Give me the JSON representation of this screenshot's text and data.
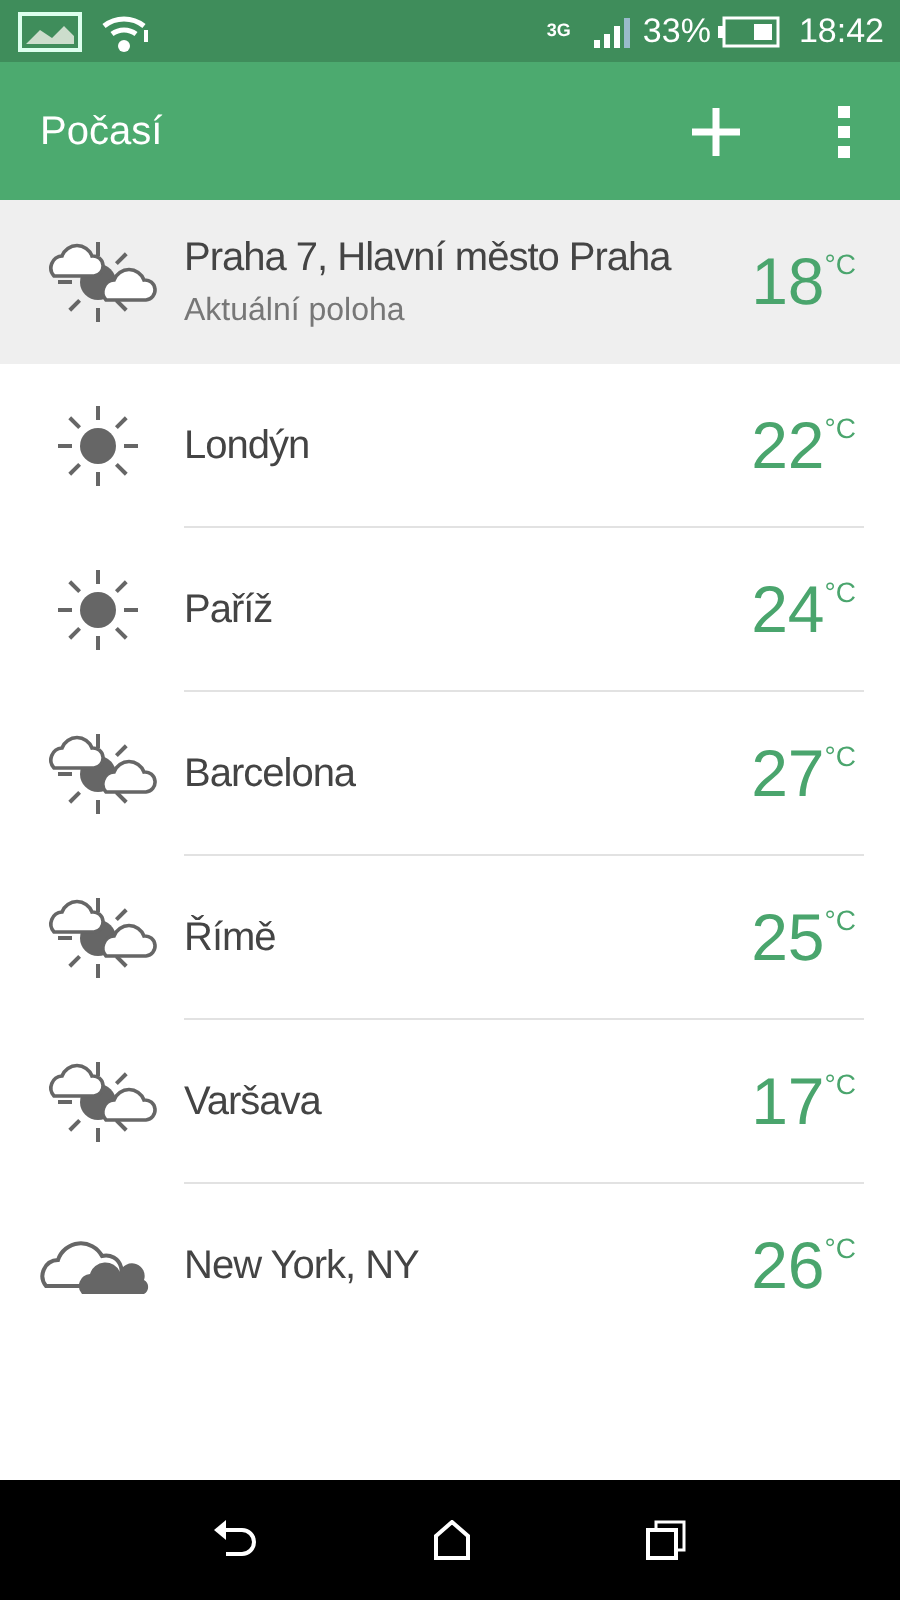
{
  "status_bar": {
    "network": "3G",
    "battery": "33%",
    "time": "18:42"
  },
  "app_bar": {
    "title": "Počasí"
  },
  "locations": [
    {
      "name": "Praha 7, Hlavní město Praha",
      "subtitle": "Aktuální poloha",
      "temp": "18",
      "unit": "°C",
      "kind": "partly_cloudy",
      "selected": true
    },
    {
      "name": "Londýn",
      "temp": "22",
      "unit": "°C",
      "kind": "sunny",
      "selected": false
    },
    {
      "name": "Paříž",
      "temp": "24",
      "unit": "°C",
      "kind": "sunny",
      "selected": false
    },
    {
      "name": "Barcelona",
      "temp": "27",
      "unit": "°C",
      "kind": "partly_cloudy",
      "selected": false
    },
    {
      "name": "Římě",
      "temp": "25",
      "unit": "°C",
      "kind": "partly_cloudy",
      "selected": false
    },
    {
      "name": "Varšava",
      "temp": "17",
      "unit": "°C",
      "kind": "partly_cloudy",
      "selected": false
    },
    {
      "name": "New York, NY",
      "temp": "26",
      "unit": "°C",
      "kind": "cloudy",
      "selected": false
    }
  ]
}
